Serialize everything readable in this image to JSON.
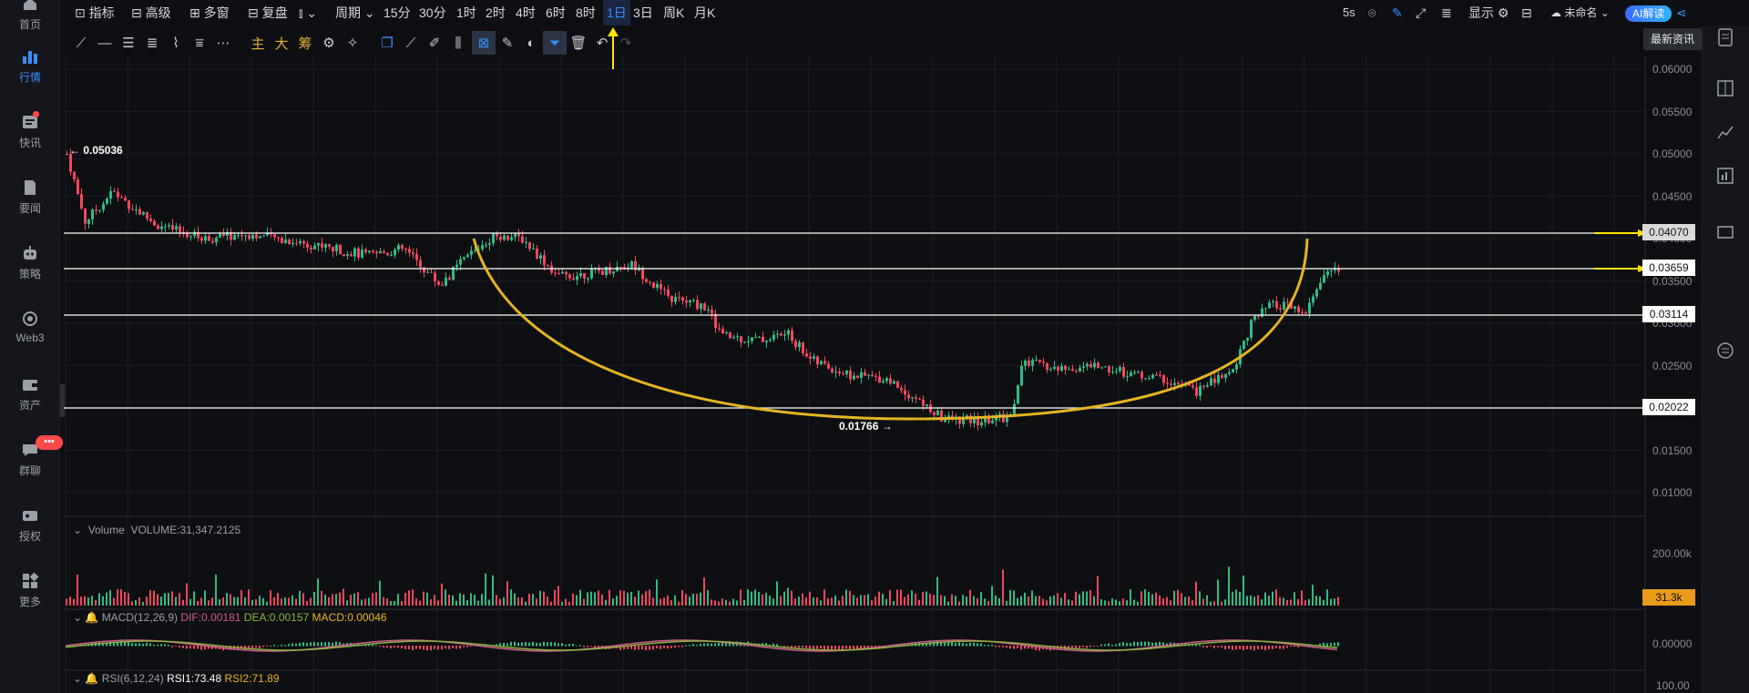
{
  "nav": {
    "items": [
      {
        "label": "首页",
        "icon": "home-icon"
      },
      {
        "label": "行情",
        "icon": "chart-bars-icon",
        "active": true
      },
      {
        "label": "快讯",
        "icon": "news-flash-icon"
      },
      {
        "label": "要闻",
        "icon": "document-icon"
      },
      {
        "label": "策略",
        "icon": "robot-icon"
      },
      {
        "label": "Web3",
        "icon": "web3-icon"
      },
      {
        "label": "资产",
        "icon": "wallet-icon"
      },
      {
        "label": "群聊",
        "icon": "chat-icon",
        "badge": "•••"
      },
      {
        "label": "授权",
        "icon": "key-icon"
      },
      {
        "label": "更多",
        "icon": "grid-more-icon"
      }
    ]
  },
  "toolbar": {
    "indicators": "指标",
    "advanced": "高级",
    "multi_window": "多窗",
    "replay": "复盘",
    "period": "周期",
    "timeframes": [
      "15分",
      "30分",
      "1时",
      "2时",
      "4时",
      "6时",
      "8时",
      "1日",
      "3日",
      "周K",
      "月K"
    ],
    "active_timeframe": "1日",
    "refresh": "5s",
    "display": "显示",
    "layout_name": "未命名",
    "ai_button": "AI解读"
  },
  "tooltip": "最新资讯",
  "drawing_tools": {
    "main": "主",
    "big": "大",
    "chip": "筹"
  },
  "chart": {
    "high_label": "0.05036",
    "low_label": "0.01766",
    "y_axis": [
      "0.06000",
      "0.05500",
      "0.05000",
      "0.04500",
      "0.04000",
      "0.03500",
      "0.03000",
      "0.02500",
      "0.02000",
      "0.01500",
      "0.01000"
    ],
    "levels": [
      "0.04070",
      "0.03659",
      "0.03114",
      "0.02022"
    ],
    "colors": {
      "up": "#2ebd85",
      "down": "#f6465d",
      "arc": "#e6b422",
      "arrow": "#ffe600",
      "accent": "#3a8cff"
    }
  },
  "volume": {
    "label": "Volume",
    "value": "VOLUME:31,347.2125",
    "axis": "200.00k",
    "current": "31.3k"
  },
  "macd": {
    "label": "MACD(12,26,9)",
    "dif": "DIF:0.00181",
    "dea": "DEA:0.00157",
    "macd": "MACD:0.00046",
    "axis": "0.00000"
  },
  "rsi": {
    "label": "RSI(6,12,24)",
    "rsi1": "RSI1:73.48",
    "rsi2": "RSI2:71.89",
    "axis": "100.00"
  }
}
